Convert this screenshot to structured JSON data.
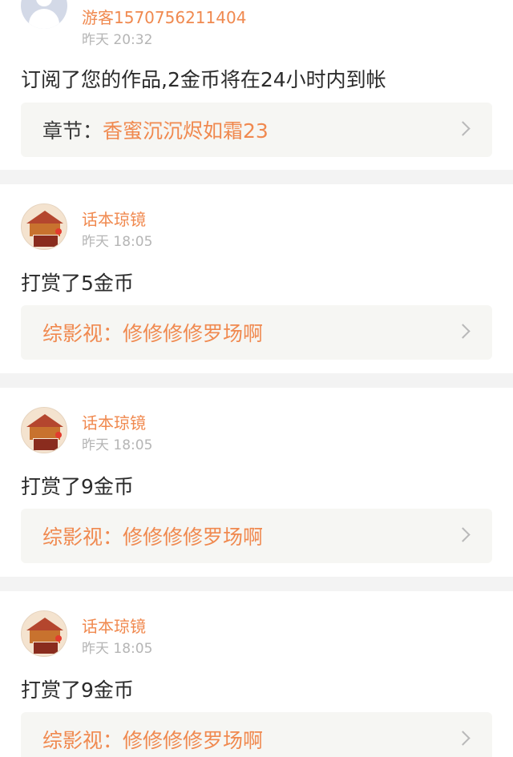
{
  "notifications": [
    {
      "avatar": "guest-avatar-icon",
      "username": "游客1570756211404",
      "time": "昨天 20:32",
      "message": "订阅了您的作品,2金币将在24小时内到帐",
      "work_label": "章节：",
      "work_title": "香蜜沉沉烬如霜23"
    },
    {
      "avatar": "huaben-logo-icon",
      "username": "话本琼镜",
      "time": "昨天 18:05",
      "message": "打赏了5金币",
      "work_label": "综影视：",
      "work_title": "修修修修罗场啊"
    },
    {
      "avatar": "huaben-logo-icon",
      "username": "话本琼镜",
      "time": "昨天 18:05",
      "message": "打赏了9金币",
      "work_label": "综影视：",
      "work_title": "修修修修罗场啊"
    },
    {
      "avatar": "huaben-logo-icon",
      "username": "话本琼镜",
      "time": "昨天 18:05",
      "message": "打赏了9金币",
      "work_label": "综影视：",
      "work_title": "修修修修罗场啊"
    }
  ],
  "colors": {
    "accent": "#f0894f",
    "label_dark": "#3a3a3a",
    "timestamp": "#b5b5b5",
    "message": "#2b2b2b",
    "work_box_bg": "#f6f6f3",
    "separator": "#f3f3f3"
  }
}
